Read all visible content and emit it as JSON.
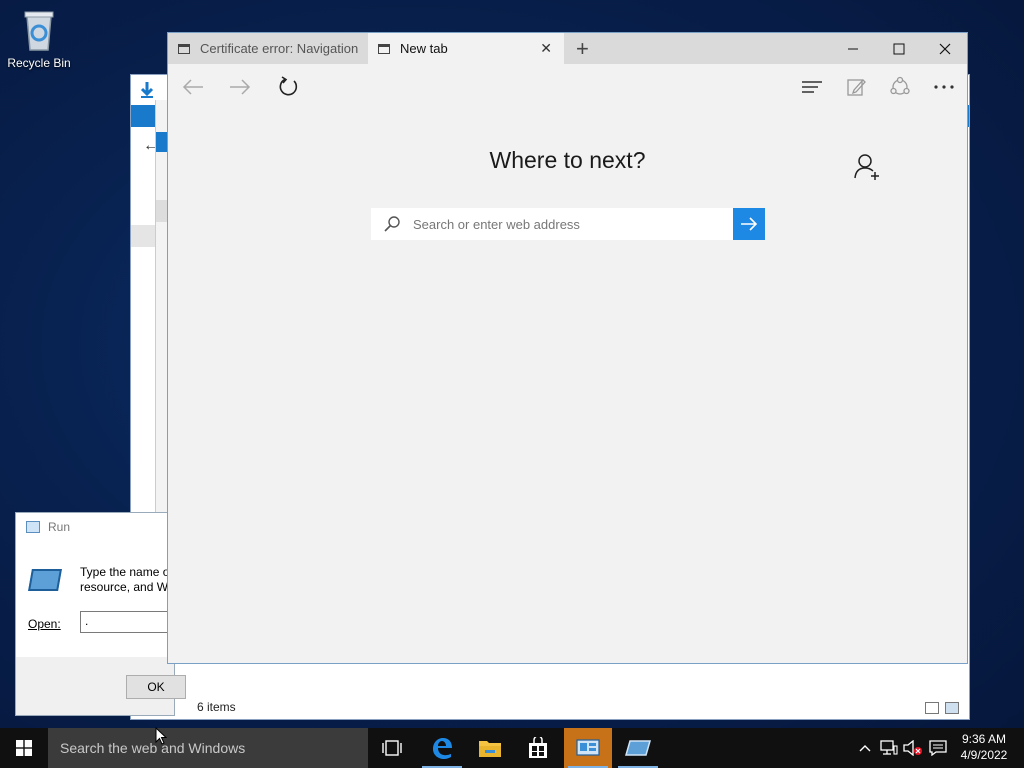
{
  "desktop": {
    "recycle_bin_label": "Recycle Bin"
  },
  "explorer": {
    "status_items": "6 items"
  },
  "run_dialog": {
    "title": "Run",
    "description_line1": "Type the name o",
    "description_line2": "resource, and Wi",
    "open_label": "Open:",
    "open_value": ".",
    "ok_label": "OK"
  },
  "browser": {
    "tabs": [
      {
        "label": "Certificate error: Navigation blocked"
      },
      {
        "label": "New tab"
      }
    ],
    "new_tab_symbol": "+",
    "heading": "Where to next?",
    "search_placeholder": "Search or enter web address",
    "accent_color": "#1e88e5"
  },
  "taskbar": {
    "search_placeholder": "Search the web and Windows",
    "clock_time": "9:36 AM",
    "clock_date": "4/9/2022",
    "highlight_color": "#c77218"
  }
}
